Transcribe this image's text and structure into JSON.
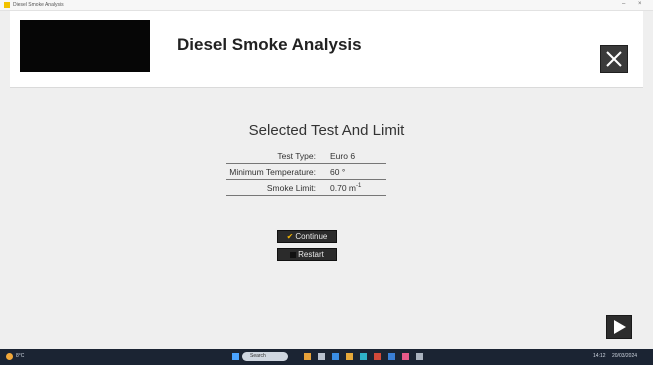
{
  "window": {
    "titlebar_text": "Diesel Smoke Analysis",
    "min_glyph": "–",
    "close_glyph": "×"
  },
  "header": {
    "title": "Diesel Smoke Analysis",
    "close_icon": "close-x-icon"
  },
  "summary": {
    "title": "Selected Test And Limit",
    "rows": [
      {
        "label": "Test Type:",
        "value": "Euro 6"
      },
      {
        "label": "Minimum Temperature:",
        "value": "60 °"
      },
      {
        "label": "Smoke Limit:",
        "value": "0.70 m",
        "unit_sup": "-1"
      }
    ]
  },
  "actions": {
    "continue_label": "Continue",
    "restart_label": "Restart"
  },
  "footer": {
    "next_icon": "play-next-icon"
  },
  "taskbar": {
    "search_placeholder": "Search",
    "weather": "8°C",
    "time": "14:12",
    "date": "20/03/2024"
  },
  "colors": {
    "accent": "#f2b400",
    "button_bg": "#2b2b2b",
    "header_bg": "#ffffff",
    "page_bg": "#efefef"
  }
}
